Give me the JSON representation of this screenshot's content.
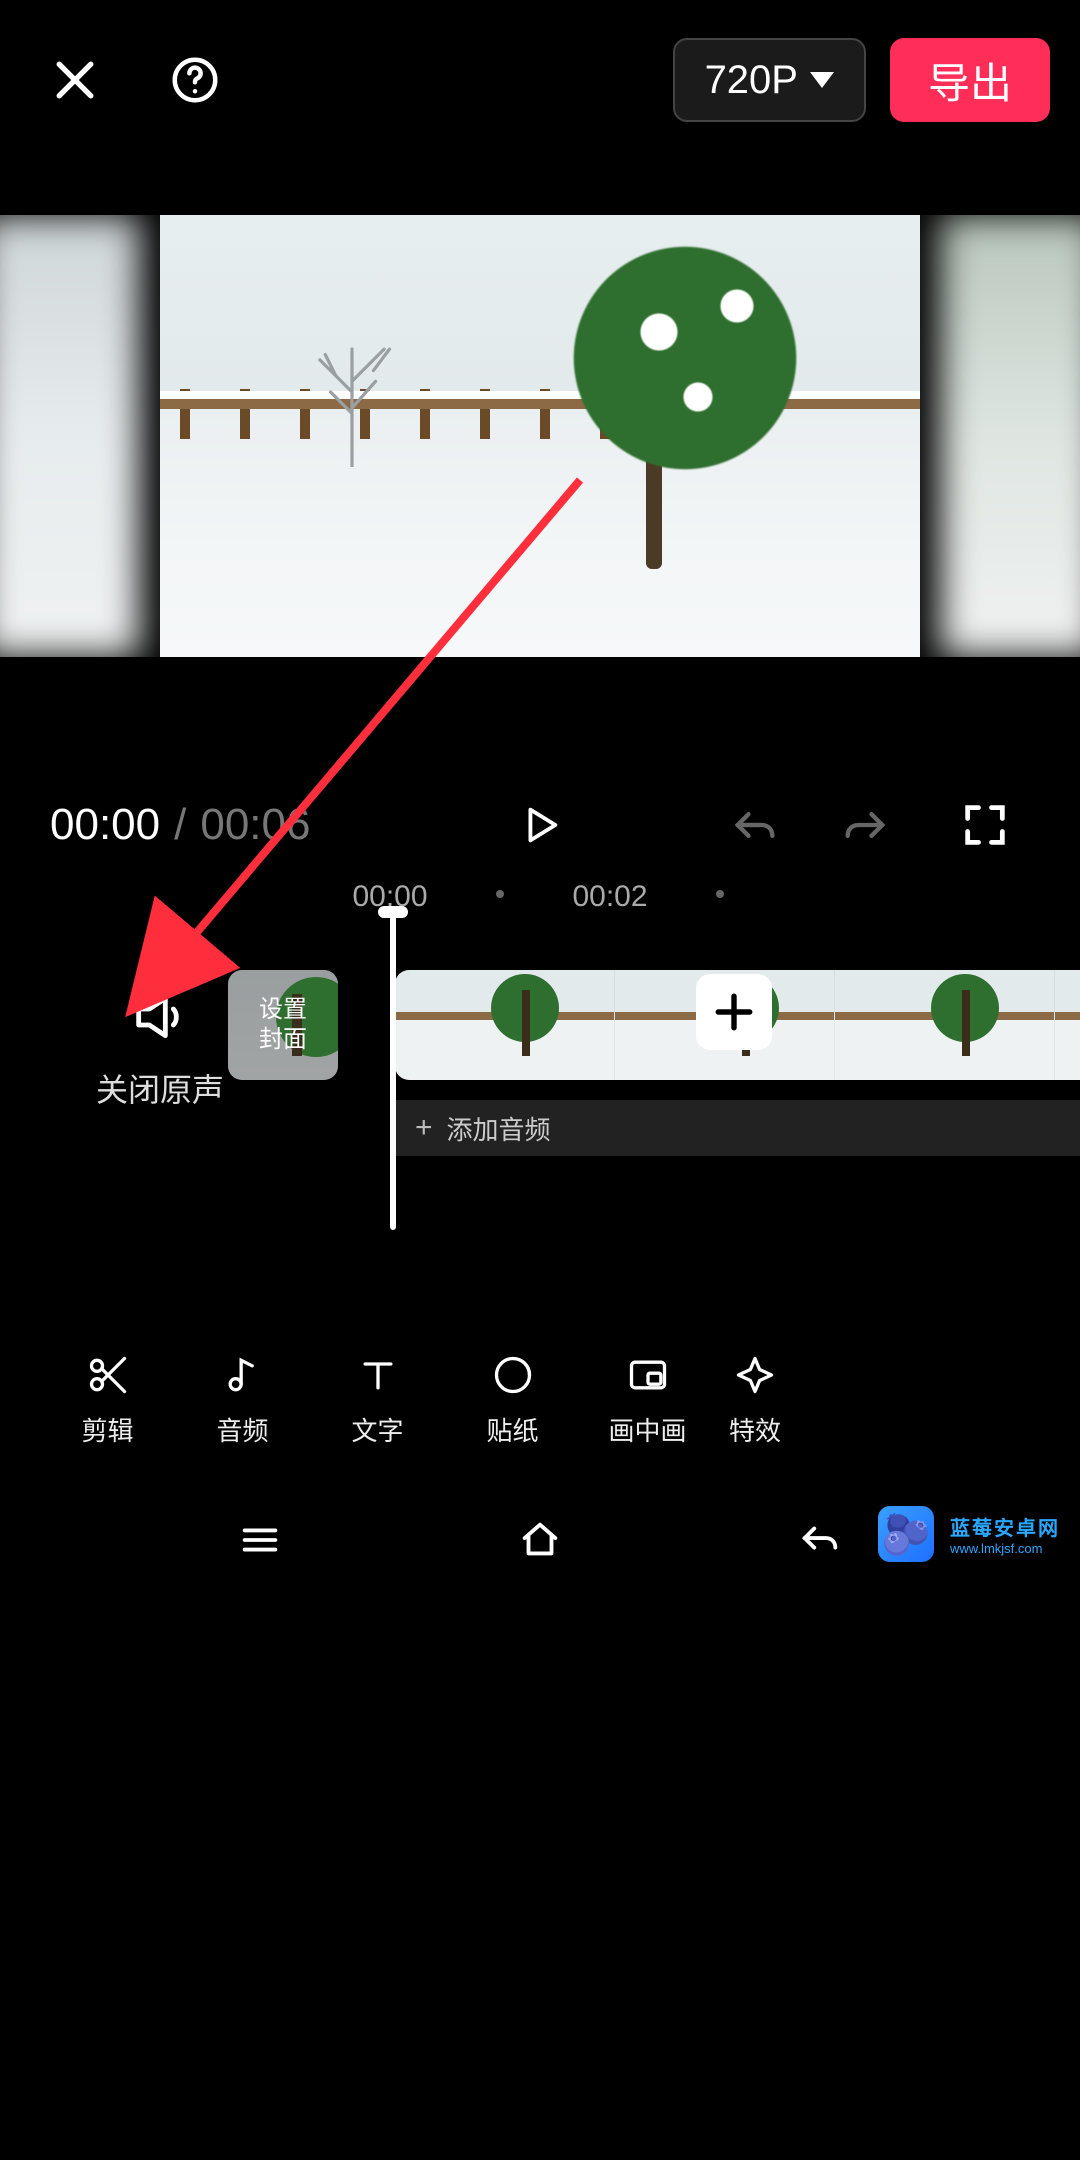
{
  "topbar": {
    "resolution_label": "720P",
    "export_label": "导出"
  },
  "playback": {
    "current_time": "00:00",
    "separator": "/",
    "total_time": "00:06"
  },
  "ruler": {
    "ticks": [
      "00:00",
      "00:02"
    ]
  },
  "tracks": {
    "mute_label": "关闭原声",
    "cover_label": "设置\n封面",
    "add_audio_label": "添加音频"
  },
  "toolbar": {
    "items": [
      {
        "id": "edit",
        "label": "剪辑"
      },
      {
        "id": "audio",
        "label": "音频"
      },
      {
        "id": "text",
        "label": "文字"
      },
      {
        "id": "sticker",
        "label": "贴纸"
      },
      {
        "id": "pip",
        "label": "画中画"
      },
      {
        "id": "effect",
        "label": "特效"
      }
    ]
  },
  "watermark": {
    "title": "蓝莓安卓网",
    "url": "www.lmkjsf.com"
  }
}
